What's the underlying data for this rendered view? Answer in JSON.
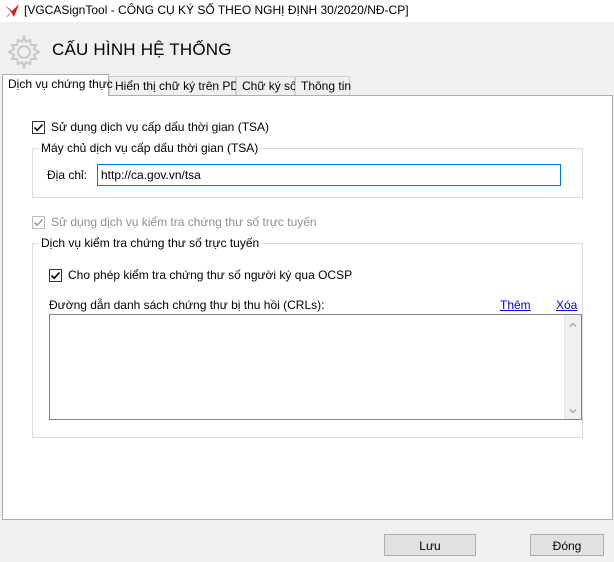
{
  "window": {
    "title": "[VGCASignTool - CÔNG CỤ KÝ SỐ THEO NGHỊ ĐỊNH 30/2020/NĐ-CP]",
    "icon": "red-pen-icon"
  },
  "header": {
    "title": "CẤU HÌNH HỆ THỐNG",
    "icon": "gear-icon"
  },
  "tabs": [
    {
      "label": "Dịch vụ chứng thực",
      "active": true
    },
    {
      "label": "Hiển thị chữ ký trên PDF",
      "active": false
    },
    {
      "label": "Chữ ký số",
      "active": false
    },
    {
      "label": "Thông tin",
      "active": false
    }
  ],
  "tsa": {
    "checkbox_label": "Sử dụng dịch vụ cấp dấu thời gian (TSA)",
    "checked": true,
    "group_title": "Máy chủ dịch vụ cấp dấu thời gian (TSA)",
    "address_label": "Địa chỉ:",
    "address_value": "http://ca.gov.vn/tsa"
  },
  "online_check": {
    "checkbox_label": "Sử dụng dịch vụ kiểm tra chứng thư số trực tuyến",
    "checked": true,
    "disabled": true,
    "group_title": "Dịch vụ kiểm tra chứng thư số trực tuyến",
    "ocsp_label": "Cho phép kiểm tra chứng thư số người ký qua OCSP",
    "ocsp_checked": true,
    "crl_label": "Đường dẫn danh sách chứng thư bị thu hồi (CRLs):",
    "add_link": "Thêm",
    "remove_link": "Xóa"
  },
  "footer": {
    "save_label": "Lưu",
    "close_label": "Đóng"
  },
  "colors": {
    "accent": "#0078d7",
    "link": "#0000ee",
    "window_bg": "#f0f0f0"
  }
}
